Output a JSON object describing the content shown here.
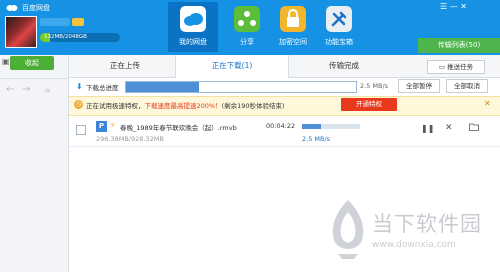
{
  "app": {
    "title": "百度网盘"
  },
  "user": {
    "quota_text": "132MB/2048GB",
    "quota_fraction": 0.12
  },
  "nav_tabs": [
    {
      "label": "我的网盘",
      "icon": "cloud-icon"
    },
    {
      "label": "分享",
      "icon": "share-icon"
    },
    {
      "label": "加密空间",
      "icon": "lock-icon"
    },
    {
      "label": "功能宝箱",
      "icon": "toolbox-icon"
    }
  ],
  "window_controls": "☰ — ✕",
  "transfer_list_button": "传输列表(50)",
  "sidebar": {
    "back_label": "收起"
  },
  "transfer_tabs": {
    "upload": "正在上传",
    "downloading": "正在下载(1)",
    "complete": "传输完成",
    "push_task": "推送任务"
  },
  "overall": {
    "label": "下载总进度",
    "percent_text": "31.9%",
    "fraction": 0.319,
    "speed": "2.5 MB/s",
    "pause_all": "全部暂停",
    "cancel_all": "全部取消"
  },
  "promo": {
    "text_before": "正在试用极速特权，",
    "text_highlight": "下载速度最高提速200%！",
    "text_after": "(剩余190秒体验结束)",
    "button": "开通特权"
  },
  "download_item": {
    "file_type_icon": "P",
    "name": "春晚_1989年春节联欢晚会（起）.rmvb",
    "size": "296.38MB/928.32MB",
    "time_left": "00:04:22",
    "progress_fraction": 0.32,
    "speed": "2.5 MB/s"
  },
  "watermark": {
    "title": "当下软件园",
    "url": "www.downxia.com"
  }
}
